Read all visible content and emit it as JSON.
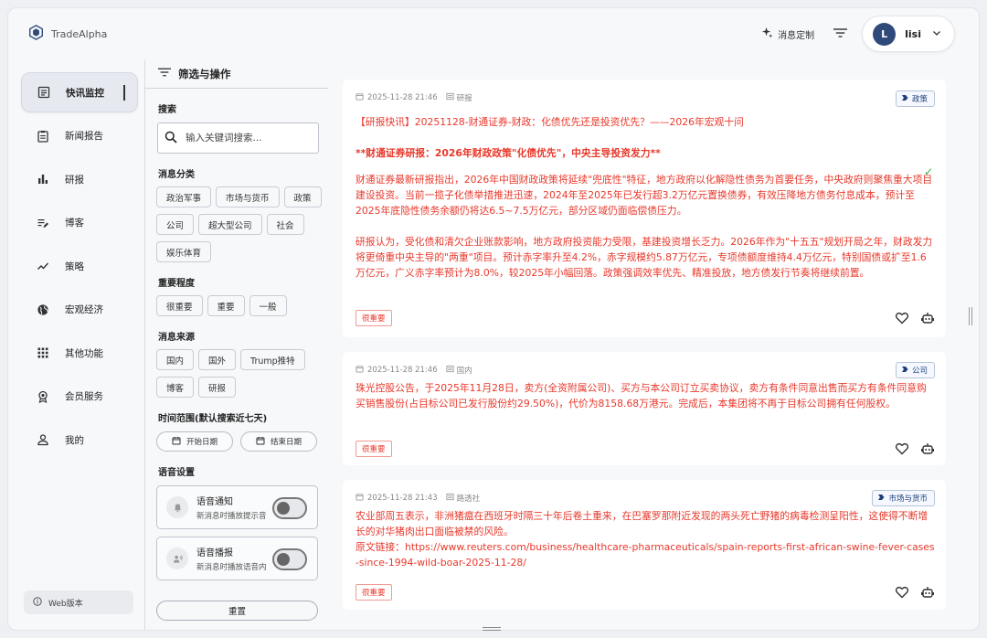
{
  "app": {
    "logo_text": "TradeAlpha"
  },
  "header": {
    "msg_custom": "消息定制",
    "user_initial": "L",
    "user_name": "lisi"
  },
  "nav": {
    "items": [
      {
        "label": "快讯监控",
        "icon": "document-icon"
      },
      {
        "label": "新闻报告",
        "icon": "clipboard-icon"
      },
      {
        "label": "研报",
        "icon": "bar-chart-icon"
      },
      {
        "label": "博客",
        "icon": "edit-list-icon"
      },
      {
        "label": "策略",
        "icon": "trend-icon"
      },
      {
        "label": "宏观经济",
        "icon": "globe-icon"
      },
      {
        "label": "其他功能",
        "icon": "grid-icon"
      },
      {
        "label": "会员服务",
        "icon": "badge-icon"
      },
      {
        "label": "我的",
        "icon": "person-icon"
      }
    ],
    "web_version": "Web版本"
  },
  "panel": {
    "title": "筛选与操作",
    "search_title": "搜索",
    "search_placeholder": "输入关键词搜索...",
    "category_title": "消息分类",
    "categories": [
      "政治军事",
      "市场与货币",
      "政策",
      "公司",
      "超大型公司",
      "社会",
      "娱乐体育"
    ],
    "importance_title": "重要程度",
    "importance": [
      "很重要",
      "重要",
      "一般"
    ],
    "source_title": "消息来源",
    "sources": [
      "国内",
      "国外",
      "Trump推特",
      "博客",
      "研报"
    ],
    "time_title": "时间范围(默认搜索近七天)",
    "start_date": "开始日期",
    "end_date": "结束日期",
    "voice_title": "语音设置",
    "voice_notify_title": "语音通知",
    "voice_notify_desc": "新消息时播放提示音",
    "voice_broadcast_title": "语音播报",
    "voice_broadcast_desc": "新消息时播放语音内",
    "reset": "重置"
  },
  "feed": [
    {
      "time": "2025-11-28 21:46",
      "source": "研报",
      "tag": "政策",
      "paragraphs": [
        "【研报快讯】20251128-财通证券-财政：化债优先还是投资优先？——2026年宏观十问",
        "**财通证券研报：2026年财政政策\"化债优先\"，中央主导投资发力**",
        "财通证券最新研报指出，2026年中国财政政策将延续\"兜底性\"特征，地方政府以化解隐性债务为首要任务，中央政府则聚焦重大项目建设投资。当前一揽子化债举措推进迅速，2024年至2025年已发行超3.2万亿元置换债券，有效压降地方债务付息成本，预计至2025年底隐性债务余额仍将达6.5~7.5万亿元，部分区域仍面临偿债压力。",
        "研报认为，受化债和清欠企业账款影响，地方政府投资能力受限，基建投资增长乏力。2026年作为\"十五五\"规划开局之年，财政发力将更倚重中央主导的\"两重\"项目。预计赤字率升至4.2%，赤字规模约5.87万亿元，专项债额度维持4.4万亿元，特别国债或扩至1.6万亿元，广义赤字率预计为8.0%，较2025年小幅回落。政策强调效率优先、精准投放，地方债发行节奏将继续前置。"
      ],
      "level": "很重要"
    },
    {
      "time": "2025-11-28 21:46",
      "source": "国内",
      "tag": "公司",
      "paragraphs": [
        "珠光控股公告，于2025年11月28日，卖方(全资附属公司)、买方与本公司订立买卖协议，卖方有条件同意出售而买方有条件同意购买销售股份(占目标公司已发行股份约29.50%)，代价为8158.68万港元。完成后，本集团将不再于目标公司拥有任何股权。"
      ],
      "level": "很重要"
    },
    {
      "time": "2025-11-28 21:43",
      "source": "路透社",
      "tag": "市场与货币",
      "paragraphs": [
        "农业部周五表示，非洲猪瘟在西班牙时隔三十年后卷土重来，在巴塞罗那附近发现的两头死亡野猪的病毒检测呈阳性，这使得不断增长的对华猪肉出口面临被禁的风险。",
        "原文链接：https://www.reuters.com/business/healthcare-pharmaceuticals/spain-reports-first-african-swine-fever-cases-since-1994-wild-boar-2025-11-28/"
      ],
      "level": "很重要"
    }
  ],
  "colors": {
    "accent_red": "#e8382b",
    "avatar_bg": "#2f4a7a",
    "tag_blue": "#1f3f7a"
  }
}
